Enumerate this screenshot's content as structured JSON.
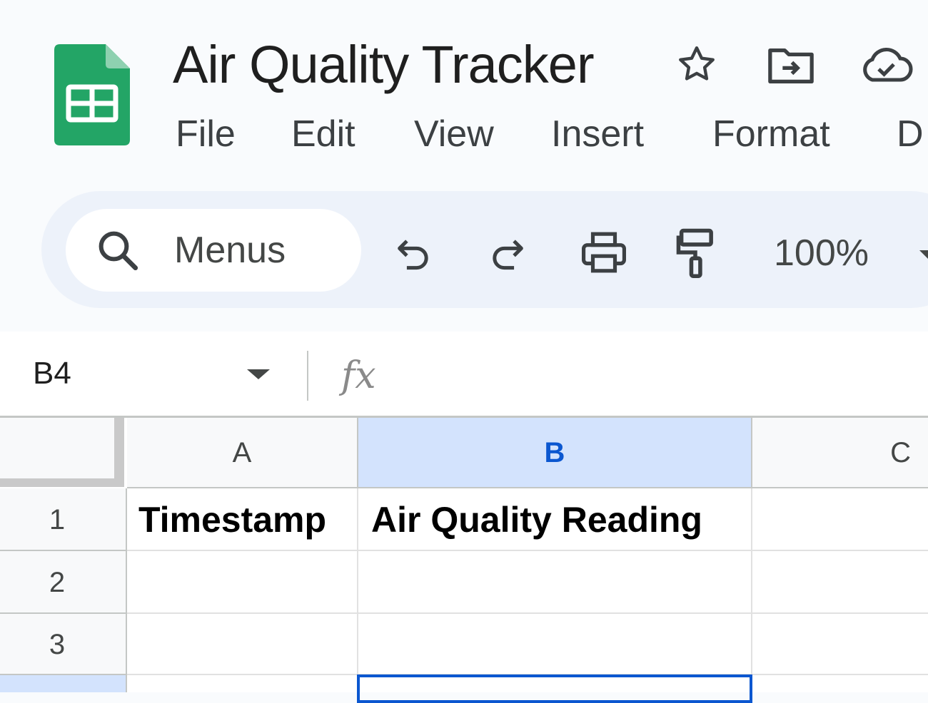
{
  "window": {
    "title": "Air Quality Tracker",
    "icons": [
      "sheets-logo",
      "star-icon",
      "move-to-folder-icon",
      "cloud-saved-icon"
    ]
  },
  "menubar": {
    "items": [
      "File",
      "Edit",
      "View",
      "Insert",
      "Format",
      "D"
    ]
  },
  "toolbar": {
    "search_label": "Menus",
    "icons": [
      "search-icon",
      "undo-icon",
      "redo-icon",
      "print-icon",
      "paint-format-icon",
      "zoom-dropdown-icon"
    ],
    "zoom": "100%"
  },
  "formula_bar": {
    "cell_ref": "B4",
    "fx_label": "fx",
    "content": ""
  },
  "grid": {
    "columns": [
      "A",
      "B",
      "C"
    ],
    "selected_column": "B",
    "rows": [
      {
        "num": "1",
        "cells": [
          "Timestamp",
          "Air Quality Reading",
          ""
        ]
      },
      {
        "num": "2",
        "cells": [
          "",
          "",
          ""
        ]
      },
      {
        "num": "3",
        "cells": [
          "",
          "",
          ""
        ]
      },
      {
        "num": "",
        "cells": [
          "",
          "",
          ""
        ]
      }
    ],
    "active_cell": "B4"
  },
  "colors": {
    "sheets_green": "#23a566",
    "selection_blue": "#0b57d0",
    "selected_header_bg": "#d3e3fd",
    "toolbar_bg": "#edf2fa"
  }
}
